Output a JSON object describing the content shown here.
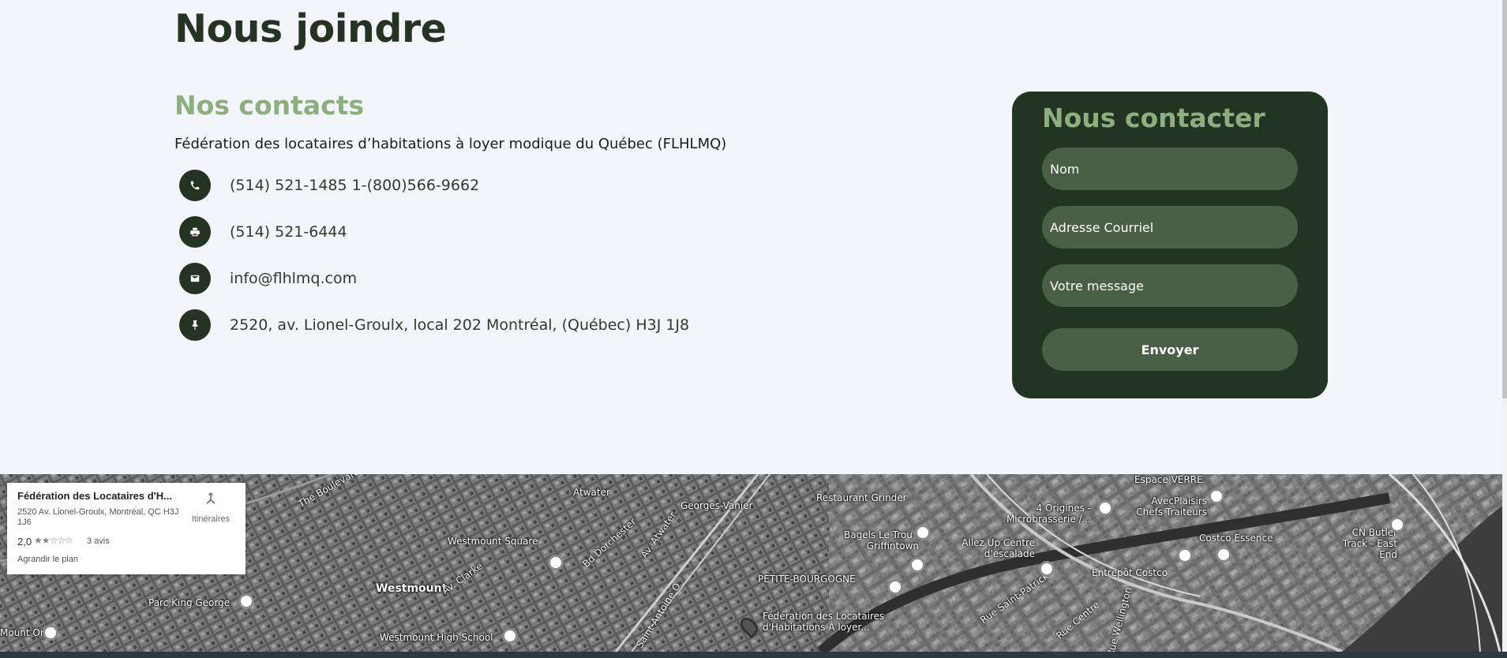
{
  "page": {
    "title": "Nous joindre"
  },
  "contacts": {
    "heading": "Nos contacts",
    "organization": "Fédération des locataires d’habitations à loyer modique du Québec (FLHLMQ)",
    "items": [
      {
        "icon": "phone-icon",
        "text": "(514) 521-1485  1-(800)566-9662"
      },
      {
        "icon": "fax-icon",
        "text": "(514) 521-6444"
      },
      {
        "icon": "envelope-icon",
        "text": "info@flhlmq.com"
      },
      {
        "icon": "pushpin-icon",
        "text": "2520, av. Lionel-Groulx, local 202 Montréal, (Québec) H3J 1J8"
      }
    ]
  },
  "form": {
    "title": "Nous contacter",
    "name_placeholder": "Nom",
    "email_placeholder": "Adresse Courriel",
    "message_placeholder": "Votre message",
    "submit_label": "Envoyer"
  },
  "map": {
    "info": {
      "name": "Fédération des Locataires d'H...",
      "address": "2520 Av. Lionel-Groulx, Montréal, QC H3J 1J6",
      "rating": "2,0",
      "stars": "★★☆☆☆",
      "reviews": "3 avis",
      "enlarge": "Agrandir le plan",
      "directions": "Itinéraires"
    },
    "labels": [
      "The Boulevard",
      "Atwater",
      "Georges-Vanier",
      "Restaurant Grinder",
      "4 Origines - Microbrasserie /...",
      "Espace VERRE",
      "AvecPlaisirs Chefs Traiteurs",
      "Westmount Square",
      "Bagels Le Trou - Griffintown",
      "Allez Up Centre d'escalade",
      "Costco Essence",
      "CN Butler Track - East End",
      "Westmount",
      "Av. Clarke",
      "Bd Dorchester",
      "Av. Atwater",
      "PETITE-BOURGOGNE",
      "Entrepôt Costco",
      "Parc King George",
      "Rue Saint-Patrick",
      "Saint-Antoine O",
      "Fédération des Locataires d'Habitations À loyer...",
      "Rue Centre",
      "Rue Wellington",
      "Westmount High School",
      "Mount One"
    ]
  }
}
